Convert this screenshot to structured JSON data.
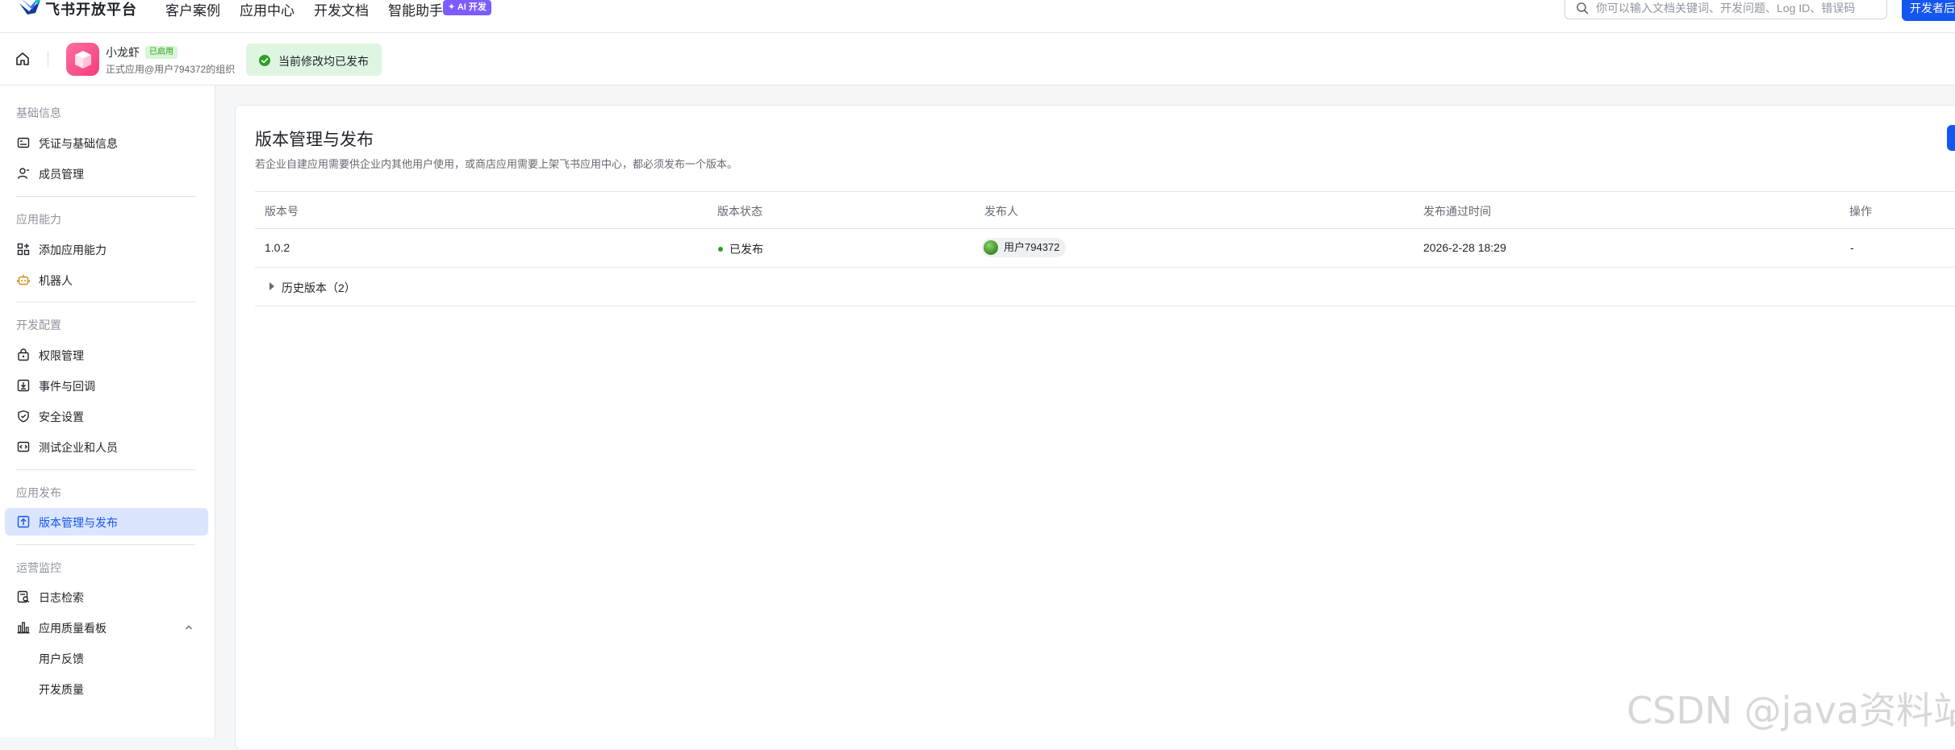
{
  "topbar": {
    "brand": "飞书开放平台",
    "nav": [
      "客户案例",
      "应用中心",
      "开发文档",
      "智能助手"
    ],
    "ai_badge": "✦ AI 开发",
    "search_placeholder": "你可以输入文档关键词、开发问题、Log ID、错误码",
    "console_button": "开发者后台"
  },
  "app": {
    "name": "小龙虾",
    "status": "已启用",
    "org": "正式应用@用户794372的组织",
    "banner": "当前修改均已发布"
  },
  "sidebar": {
    "groups": [
      {
        "title": "基础信息",
        "items": [
          {
            "label": "凭证与基础信息",
            "icon": "id-card-icon"
          },
          {
            "label": "成员管理",
            "icon": "member-icon"
          }
        ]
      },
      {
        "title": "应用能力",
        "items": [
          {
            "label": "添加应用能力",
            "icon": "add-capability-icon"
          },
          {
            "label": "机器人",
            "icon": "robot-icon"
          }
        ]
      },
      {
        "title": "开发配置",
        "items": [
          {
            "label": "权限管理",
            "icon": "permission-icon"
          },
          {
            "label": "事件与回调",
            "icon": "event-icon"
          },
          {
            "label": "安全设置",
            "icon": "shield-icon"
          },
          {
            "label": "测试企业和人员",
            "icon": "test-icon"
          }
        ]
      },
      {
        "title": "应用发布",
        "items": [
          {
            "label": "版本管理与发布",
            "icon": "upload-icon",
            "active": true
          }
        ]
      },
      {
        "title": "运营监控",
        "items": [
          {
            "label": "日志检索",
            "icon": "log-search-icon"
          },
          {
            "label": "应用质量看板",
            "icon": "bar-chart-icon"
          },
          {
            "label": "用户反馈"
          },
          {
            "label": "开发质量"
          }
        ]
      }
    ]
  },
  "main": {
    "title": "版本管理与发布",
    "description": "若企业自建应用需要供企业内其他用户使用，或商店应用需要上架飞书应用中心，都必须发布一个版本。",
    "columns": [
      "版本号",
      "版本状态",
      "发布人",
      "发布通过时间",
      "操作"
    ],
    "rows": [
      {
        "version": "1.0.2",
        "status": "已发布",
        "publisher": "用户794372",
        "time": "2026-2-28 18:29",
        "action": "-"
      }
    ],
    "history_label": "历史版本（2）"
  },
  "colors": {
    "accent": "#1456f0",
    "success": "#2ea121",
    "active_bg": "#dbe5fd"
  },
  "watermark": "CSDN @java资料站"
}
